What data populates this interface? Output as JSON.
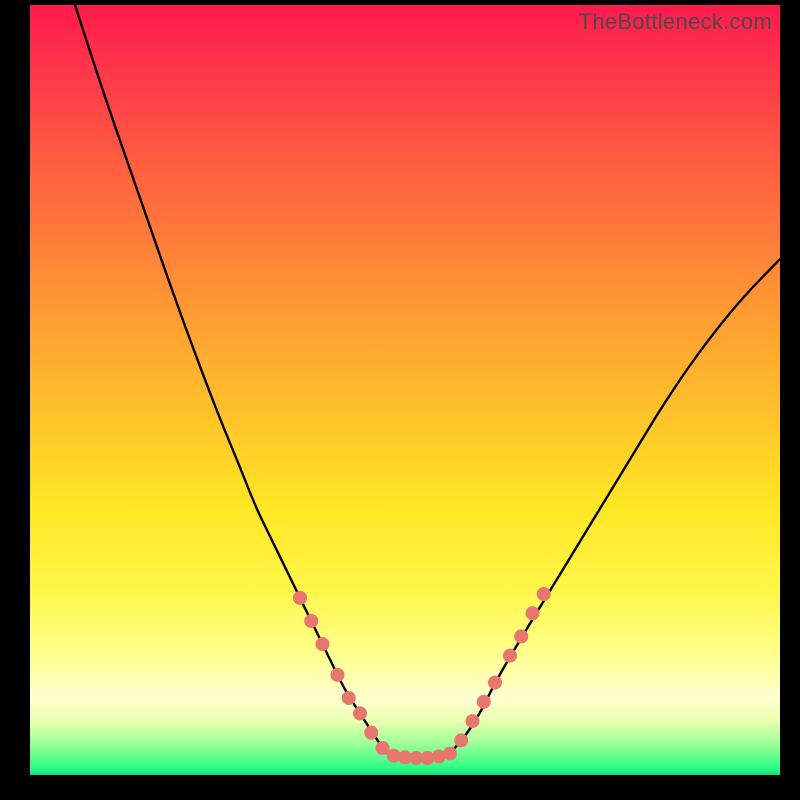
{
  "watermark": "TheBottleneck.com",
  "chart_data": {
    "type": "line",
    "title": "",
    "xlabel": "",
    "ylabel": "",
    "xlim": [
      0,
      100
    ],
    "ylim": [
      0,
      100
    ],
    "grid": false,
    "series": [
      {
        "name": "left-curve",
        "x": [
          6,
          10,
          15,
          20,
          25,
          28,
          30,
          32,
          34,
          36,
          38,
          40,
          42,
          44,
          46,
          47,
          48
        ],
        "y": [
          100,
          88,
          74,
          60,
          47,
          40,
          35,
          31,
          27,
          23,
          19,
          15,
          11,
          8,
          5,
          3.5,
          2.5
        ]
      },
      {
        "name": "flat-bottom",
        "x": [
          48,
          49,
          50,
          51,
          52,
          53,
          54,
          55,
          56
        ],
        "y": [
          2.5,
          2.3,
          2.2,
          2.2,
          2.2,
          2.2,
          2.3,
          2.5,
          2.8
        ]
      },
      {
        "name": "right-curve",
        "x": [
          56,
          58,
          60,
          62,
          65,
          70,
          75,
          80,
          85,
          90,
          95,
          100
        ],
        "y": [
          2.8,
          5,
          8,
          12,
          17,
          25,
          33,
          41,
          49,
          56,
          62,
          67
        ]
      }
    ],
    "markers": [
      {
        "name": "left-markers",
        "points": [
          {
            "x": 36,
            "y": 23
          },
          {
            "x": 37.5,
            "y": 20
          },
          {
            "x": 39,
            "y": 17
          },
          {
            "x": 41,
            "y": 13
          },
          {
            "x": 42.5,
            "y": 10
          },
          {
            "x": 44,
            "y": 8
          },
          {
            "x": 45.5,
            "y": 5.5
          },
          {
            "x": 47,
            "y": 3.5
          }
        ]
      },
      {
        "name": "bottom-markers",
        "points": [
          {
            "x": 48.5,
            "y": 2.5
          },
          {
            "x": 50,
            "y": 2.3
          },
          {
            "x": 51.5,
            "y": 2.2
          },
          {
            "x": 53,
            "y": 2.2
          },
          {
            "x": 54.5,
            "y": 2.4
          },
          {
            "x": 56,
            "y": 2.8
          }
        ]
      },
      {
        "name": "right-markers",
        "points": [
          {
            "x": 57.5,
            "y": 4.5
          },
          {
            "x": 59,
            "y": 7
          },
          {
            "x": 60.5,
            "y": 9.5
          },
          {
            "x": 62,
            "y": 12
          },
          {
            "x": 64,
            "y": 15.5
          },
          {
            "x": 65.5,
            "y": 18
          },
          {
            "x": 67,
            "y": 21
          },
          {
            "x": 68.5,
            "y": 23.5
          }
        ]
      }
    ]
  },
  "colors": {
    "background": "#000000",
    "curve": "#000000",
    "marker": "#e8756e"
  }
}
